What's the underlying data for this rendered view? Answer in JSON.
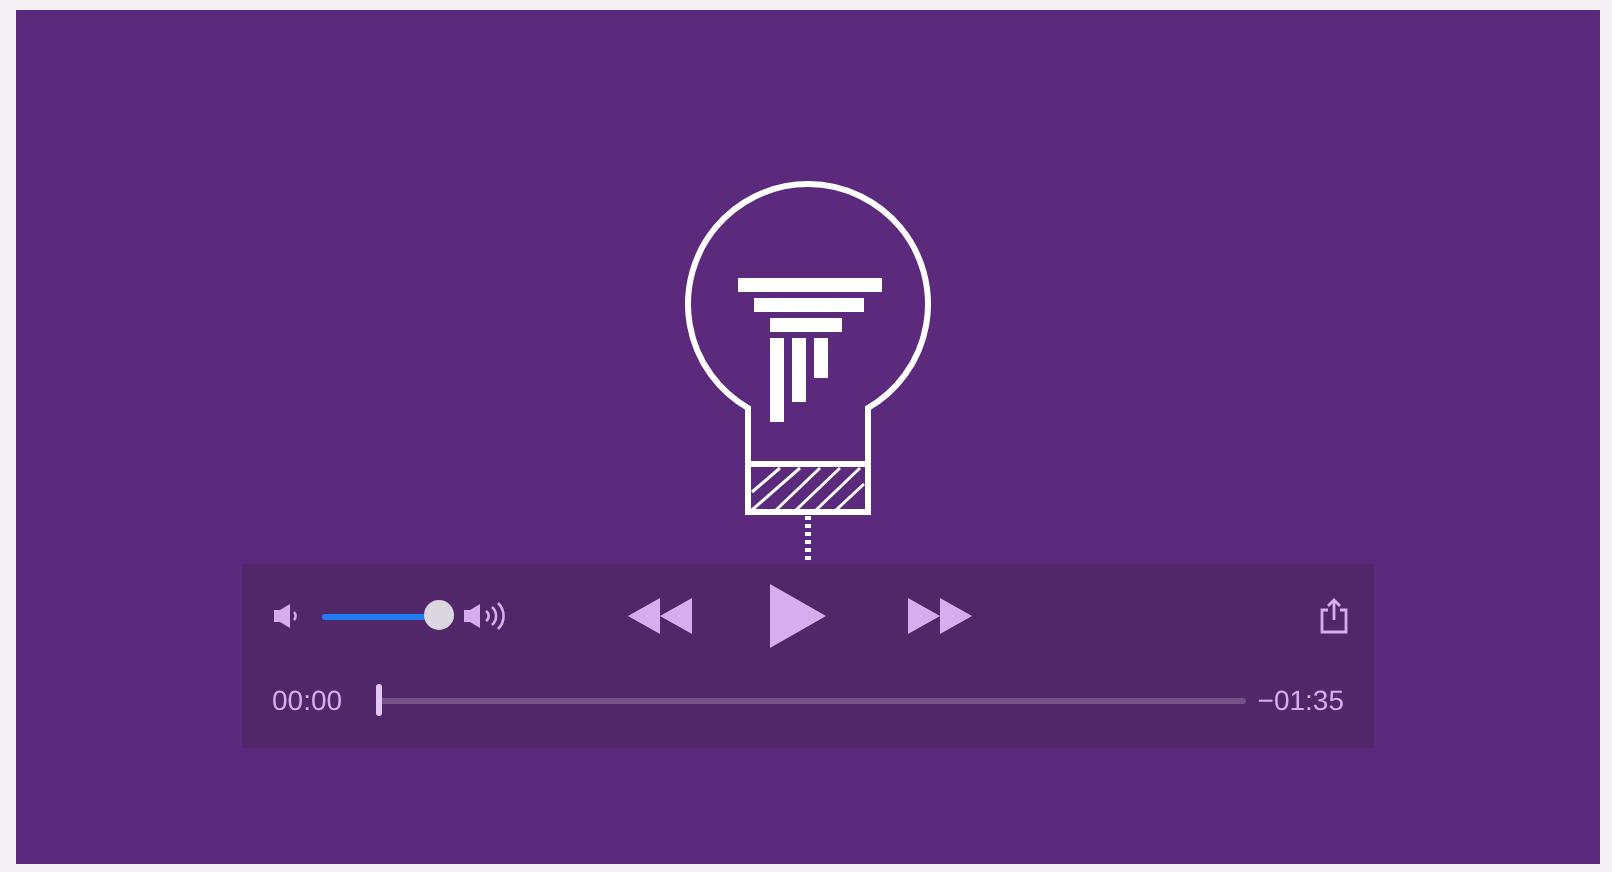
{
  "player": {
    "volume": {
      "level": 1.0
    },
    "progress": {
      "level": 0.0
    },
    "elapsed": "00:00",
    "remaining": "−01:35"
  }
}
